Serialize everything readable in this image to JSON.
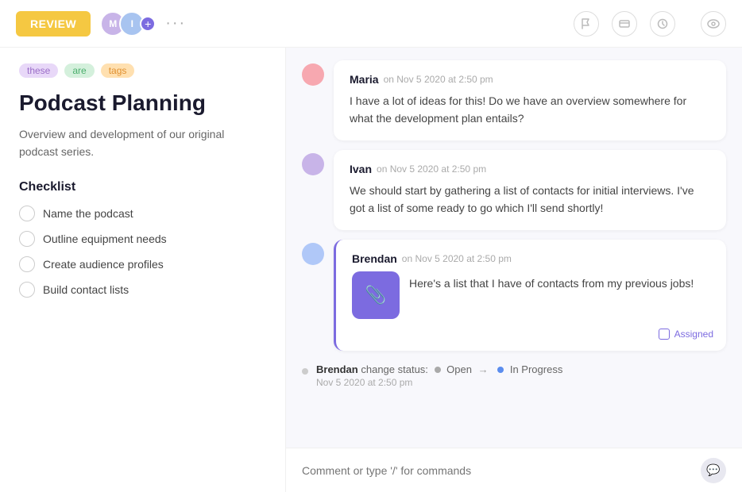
{
  "topbar": {
    "review_label": "REVIEW",
    "dots": "···"
  },
  "tags": [
    {
      "id": "these",
      "label": "these",
      "class": "tag-these"
    },
    {
      "id": "are",
      "label": "are",
      "class": "tag-are"
    },
    {
      "id": "tags",
      "label": "tags",
      "class": "tag-tags"
    }
  ],
  "left": {
    "title": "Podcast Planning",
    "description": "Overview and development of our original podcast series.",
    "checklist_title": "Checklist",
    "checklist_items": [
      "Name the podcast",
      "Outline equipment needs",
      "Create audience profiles",
      "Build contact lists"
    ]
  },
  "messages": [
    {
      "author": "Maria",
      "time": "on Nov 5 2020 at 2:50 pm",
      "body": "I have a lot of ideas for this! Do we have an overview somewhere for what the development plan entails?",
      "avatar_class": "pink",
      "highlighted": false
    },
    {
      "author": "Ivan",
      "time": "on Nov 5 2020 at 2:50 pm",
      "body": "We should start by gathering a list of contacts for initial interviews. I've got a list of some ready to go which I'll send shortly!",
      "avatar_class": "lavender",
      "highlighted": false
    },
    {
      "author": "Brendan",
      "time": "on Nov 5 2020 at 2:50 pm",
      "body": "Here's a list that I have of contacts from my previous jobs!",
      "avatar_class": "blue",
      "highlighted": true,
      "has_attachment": true,
      "assigned_label": "Assigned"
    }
  ],
  "status_change": {
    "author": "Brendan",
    "action": "change status:",
    "from": "Open",
    "to": "In Progress",
    "time": "Nov 5 2020 at 2:50 pm"
  },
  "comment_placeholder": "Comment or type '/' for commands"
}
